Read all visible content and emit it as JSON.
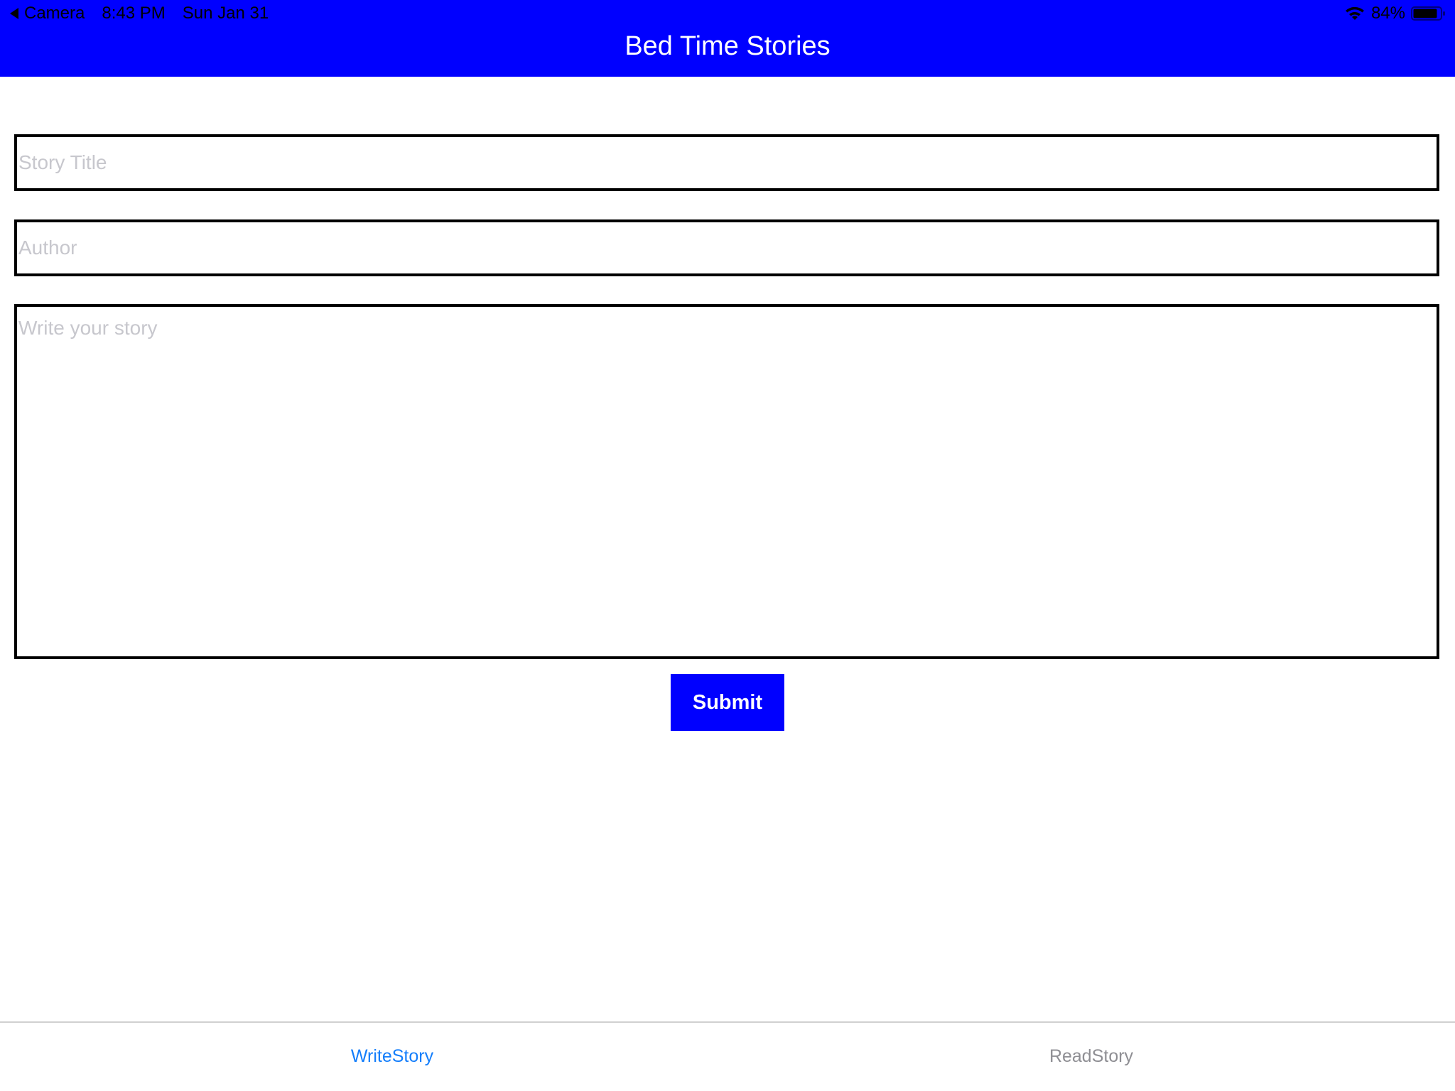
{
  "status_bar": {
    "back_app": "Camera",
    "time": "8:43 PM",
    "date": "Sun Jan 31",
    "battery": "84%"
  },
  "header": {
    "title": "Bed Time Stories",
    "background": "#0000ff"
  },
  "form": {
    "title_placeholder": "Story Title",
    "title_value": "",
    "author_placeholder": "Author",
    "author_value": "",
    "story_placeholder": "Write your story",
    "story_value": "",
    "submit_label": "Submit"
  },
  "tabs": [
    {
      "label": "WriteStory",
      "active": true
    },
    {
      "label": "ReadStory",
      "active": false
    }
  ],
  "colors": {
    "accent": "#0000ff",
    "tab_active": "#147efb",
    "tab_inactive": "#8e8e93"
  }
}
